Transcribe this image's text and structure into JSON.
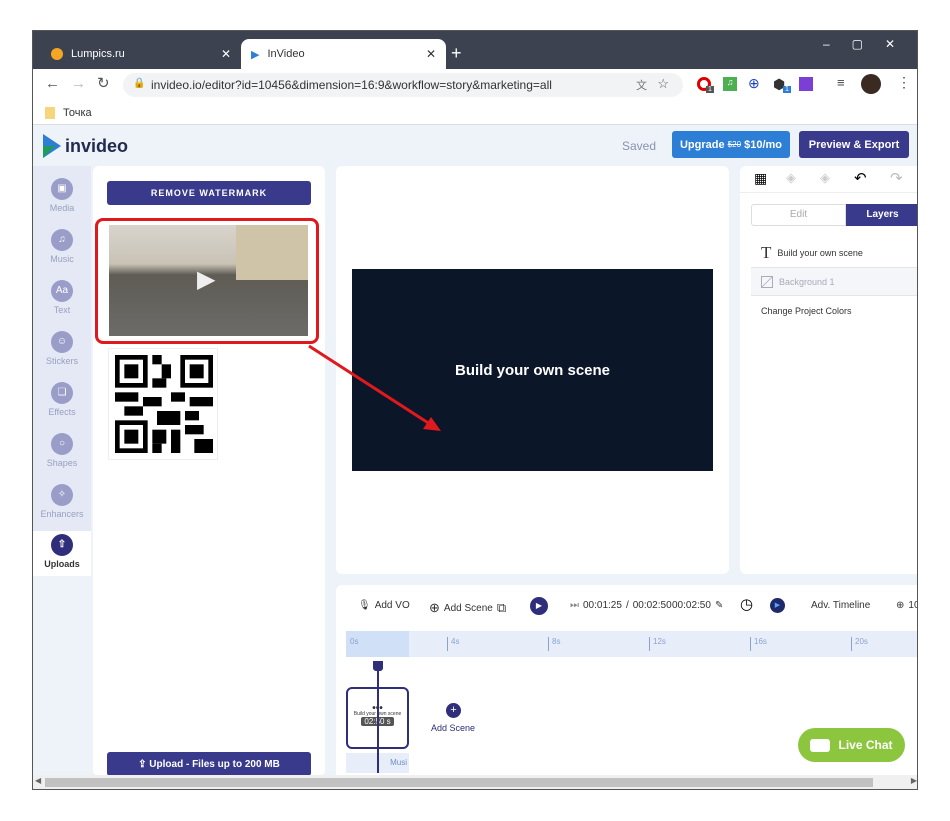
{
  "browser": {
    "tabs": [
      {
        "label": "Lumpics.ru",
        "active": false
      },
      {
        "label": "InVideo",
        "active": true
      }
    ],
    "url": "invideo.io/editor?id=10456&dimension=16:9&workflow=story&marketing=all",
    "bookmark": "Точка",
    "badges": [
      "1",
      "1"
    ]
  },
  "header": {
    "logo": "invideo",
    "saved": "Saved",
    "upgrade_label": "Upgrade",
    "upgrade_old_price": "$20",
    "upgrade_price": "$10/mo",
    "export_label": "Preview & Export"
  },
  "nav": [
    {
      "label": "Media"
    },
    {
      "label": "Music"
    },
    {
      "label": "Text",
      "glyph": "Aa"
    },
    {
      "label": "Stickers"
    },
    {
      "label": "Effects"
    },
    {
      "label": "Shapes"
    },
    {
      "label": "Enhancers"
    },
    {
      "label": "Uploads",
      "active": true
    }
  ],
  "panel": {
    "remove_watermark": "REMOVE WATERMARK",
    "upload_label": "Upload - Files up to 200 MB"
  },
  "canvas": {
    "scene_text": "Build your own scene"
  },
  "right": {
    "tabs": [
      "Edit",
      "Layers"
    ],
    "active_tab": "Layers",
    "layers": [
      "Build your own scene",
      "Background 1"
    ],
    "change_colors": "Change Project Colors"
  },
  "timeline": {
    "add_vo": "Add VO",
    "add_scene": "Add Scene",
    "current_time": "00:01:25",
    "total_time": "00:02:50",
    "duration": "00:02:50",
    "adv_timeline": "Adv. Timeline",
    "zoom": "10",
    "ticks": [
      "0s",
      "4s",
      "8s",
      "12s",
      "16s",
      "20s"
    ],
    "scene_card_title": "Build your own scene",
    "scene_card_duration": "02:50 s",
    "music_label": "Musi",
    "add_scene_below": "Add Scene"
  },
  "chat": {
    "label": "Live Chat"
  },
  "colors": {
    "primary": "#3a3a8c",
    "upgrade": "#2d7fd6",
    "chat": "#8cc63f",
    "highlight": "#e0191c"
  }
}
